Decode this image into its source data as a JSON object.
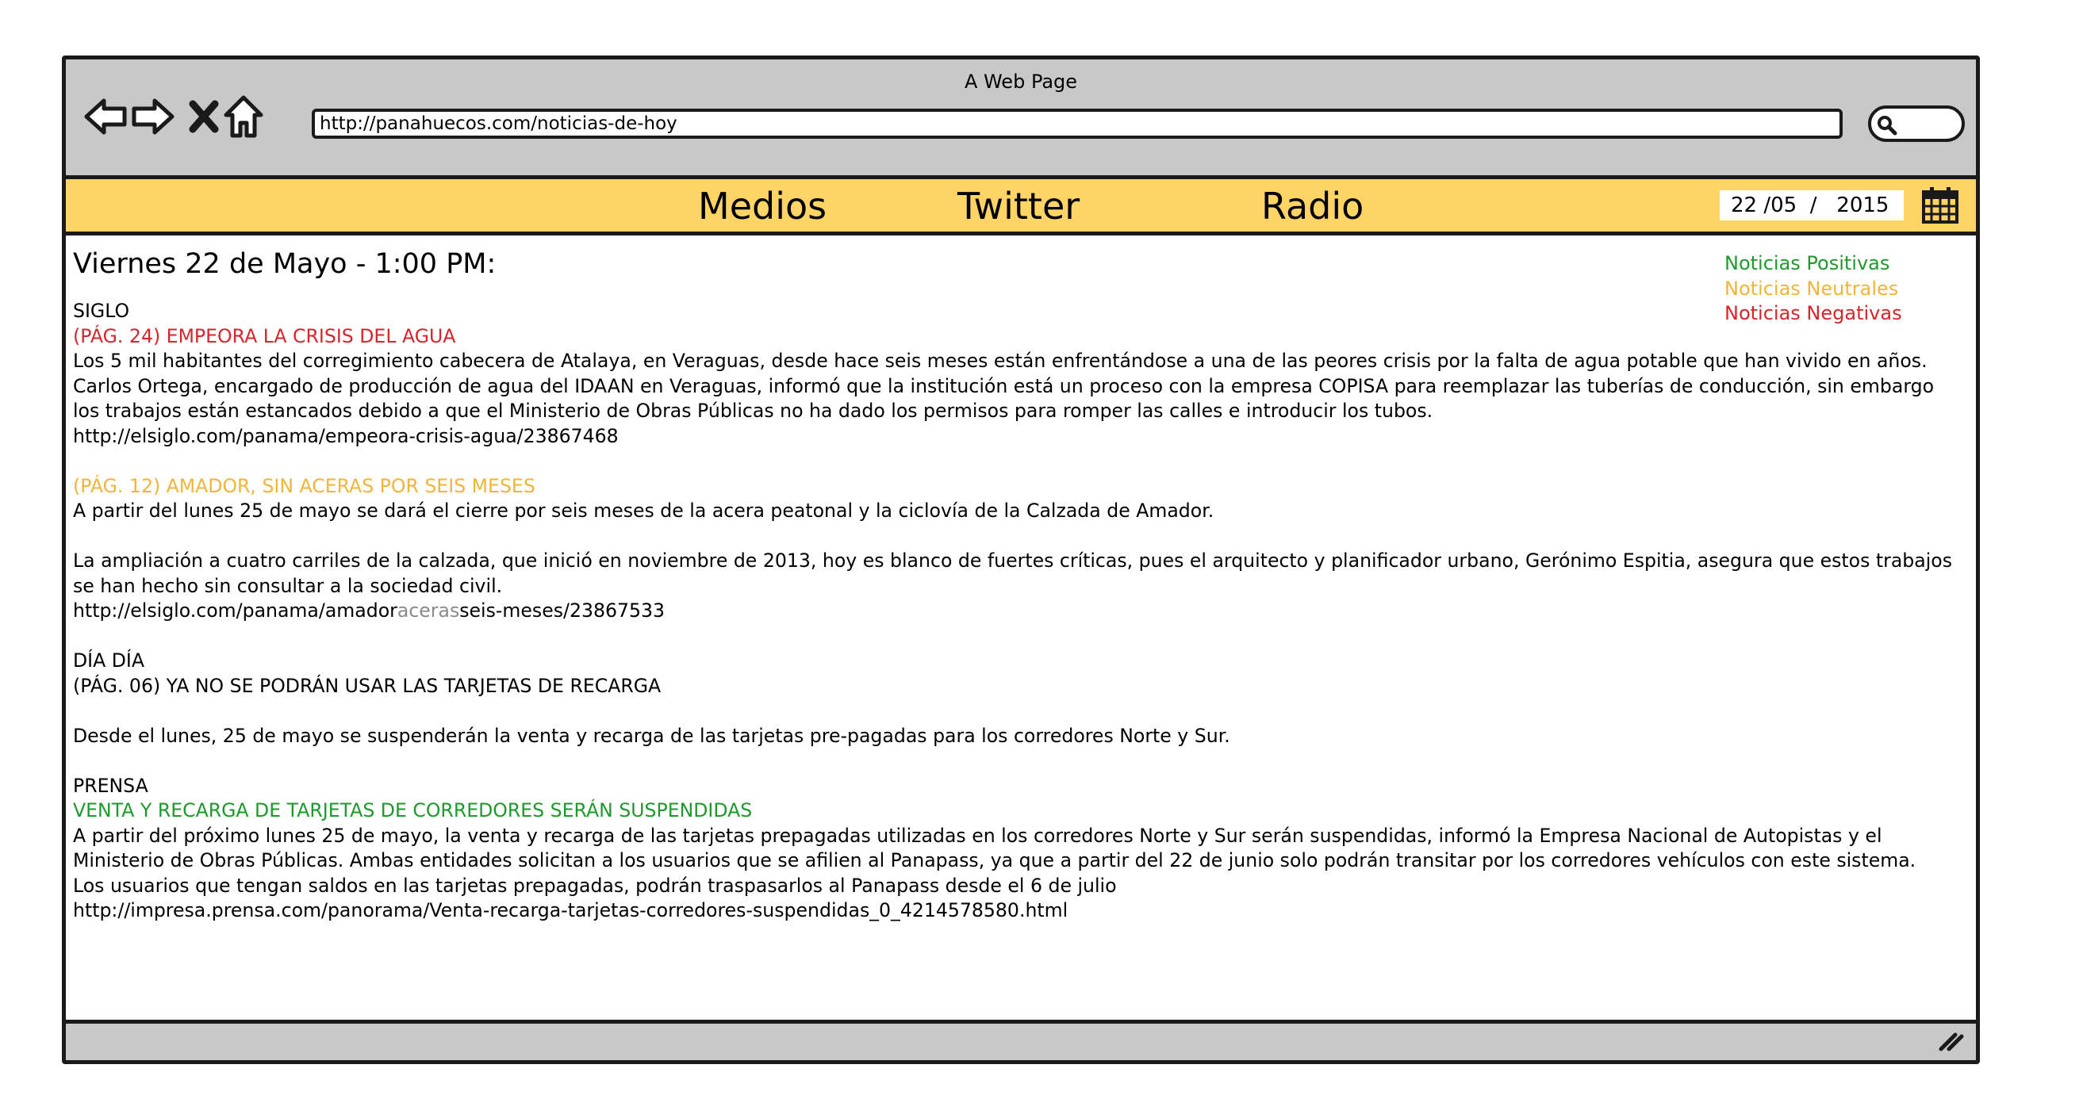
{
  "window": {
    "title": "A Web Page",
    "url": "http://panahuecos.com/noticias-de-hoy"
  },
  "nav": {
    "links": [
      "Medios",
      "Twitter",
      "Radio"
    ],
    "date": "22 /05  /   2015"
  },
  "page": {
    "title": "Viernes 22 de Mayo - 1:00 PM:"
  },
  "legend": {
    "positive": "Noticias Positivas",
    "neutral": "Noticias Neutrales",
    "negative": "Noticias Negativas"
  },
  "colors": {
    "positive": "#1e9a2c",
    "neutral": "#f2b53a",
    "negative": "#d9242a",
    "navbar": "#ffd466",
    "chrome": "#c8c8c8"
  },
  "articles": {
    "siglo": {
      "source": "SIGLO",
      "a1": {
        "headline": " (PÁG. 24) EMPEORA LA CRISIS DEL AGUA",
        "line1": "Los 5 mil habitantes del corregimiento cabecera de Atalaya, en Veraguas, desde hace seis meses están enfrentándose a una de las peores crisis por la falta de agua potable que han vivido en años.",
        "line2": "Carlos Ortega, encargado de producción de agua del IDAAN en Veraguas, informó que la institución está un proceso con la empresa COPISA para reemplazar las tuberías de conducción, sin embargo",
        "line3": "los trabajos están estancados debido a que el Ministerio de Obras Públicas no ha dado los permisos para romper las calles e introducir los tubos.",
        "url": "http://elsiglo.com/panama/empeora-crisis-agua/23867468"
      },
      "a2": {
        "headline": "(PÁG. 12) AMADOR, SIN ACERAS POR SEIS MESES",
        "line1": "A partir del lunes 25 de mayo se dará el cierre por seis meses de la acera peatonal y la ciclovía de la Calzada de Amador.",
        "line2": "La ampliación a cuatro carriles de la calzada, que inició en noviembre de 2013, hoy es blanco de fuertes críticas, pues el arquitecto y planificador urbano, Gerónimo Espitia, asegura que estos trabajos",
        "line3": "se han hecho sin consultar a la sociedad civil.",
        "url_a": "http://elsiglo.com/panama/amador",
        "url_b": "aceras",
        "url_c": "seis-meses/23867533"
      }
    },
    "diadia": {
      "source": "DÍA DÍA",
      "headline": "(PÁG. 06) YA NO SE PODRÁN USAR LAS TARJETAS DE RECARGA",
      "line1": "Desde el lunes, 25 de mayo se suspenderán la venta y recarga de las tarjetas pre-pagadas para los corredores Norte y Sur."
    },
    "prensa": {
      "source": "PRENSA",
      "headline": "VENTA Y RECARGA DE TARJETAS DE CORREDORES SERÁN SUSPENDIDAS",
      "line1": "A partir del próximo lunes 25 de mayo, la venta y recarga de las tarjetas prepagadas utilizadas en los corredores Norte y Sur serán suspendidas, informó la Empresa Nacional de Autopistas y el",
      "line2": "Ministerio de Obras Públicas. Ambas entidades solicitan a los usuarios que se afilien al Panapass, ya que a partir del 22 de junio solo podrán transitar por los corredores vehículos con este sistema.",
      "line3": "Los usuarios que tengan saldos en las tarjetas prepagadas, podrán traspasarlos al Panapass desde el 6 de julio",
      "url": "http://impresa.prensa.com/panorama/Venta-recarga-tarjetas-corredores-suspendidas_0_4214578580.html"
    }
  },
  "icons": [
    "back-arrow-icon",
    "forward-arrow-icon",
    "close-icon",
    "home-icon",
    "search-icon",
    "calendar-icon",
    "resize-handle-icon"
  ]
}
